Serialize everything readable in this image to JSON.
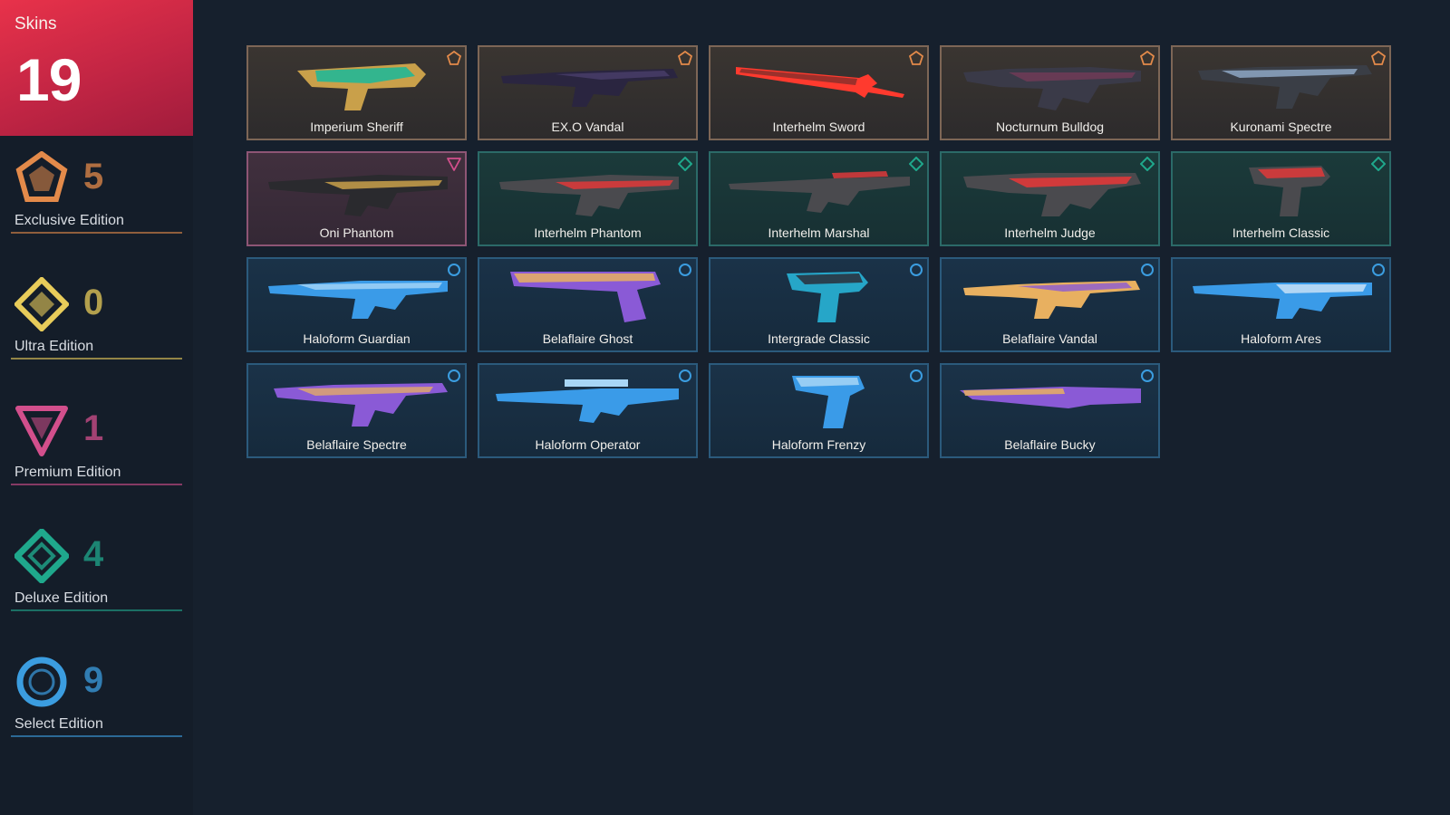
{
  "sidebar": {
    "header": {
      "label": "Skins",
      "count": "19",
      "color": "#d42a46"
    },
    "tiers": [
      {
        "id": "exclusive",
        "count": "5",
        "name": "Exclusive Edition",
        "color": "#e38a4a",
        "icon": "exclusive-edition-icon"
      },
      {
        "id": "ultra",
        "count": "0",
        "name": "Ultra Edition",
        "color": "#e8cc5a",
        "icon": "ultra-edition-icon"
      },
      {
        "id": "premium",
        "count": "1",
        "name": "Premium Edition",
        "color": "#d24f8c",
        "icon": "premium-edition-icon"
      },
      {
        "id": "deluxe",
        "count": "4",
        "name": "Deluxe Edition",
        "color": "#1fa88c",
        "icon": "deluxe-edition-icon"
      },
      {
        "id": "select",
        "count": "9",
        "name": "Select Edition",
        "color": "#3b9de0",
        "icon": "select-edition-icon"
      }
    ]
  },
  "skins": [
    {
      "name": "Imperium Sheriff",
      "tier": "exclusive",
      "palette": [
        "#19b89a",
        "#c9a04a"
      ],
      "icon": "sheriff-icon"
    },
    {
      "name": "EX.O Vandal",
      "tier": "exclusive",
      "palette": [
        "#4a3f6a",
        "#2a2540"
      ],
      "icon": "vandal-icon"
    },
    {
      "name": "Interhelm Sword",
      "tier": "exclusive",
      "palette": [
        "#ff3a2e",
        "#5a2a2a"
      ],
      "icon": "sword-icon"
    },
    {
      "name": "Nocturnum Bulldog",
      "tier": "exclusive",
      "palette": [
        "#3a3a48",
        "#7a3a5a"
      ],
      "icon": "bulldog-icon"
    },
    {
      "name": "Kuronami Spectre",
      "tier": "exclusive",
      "palette": [
        "#3a3e46",
        "#9ab6d6"
      ],
      "icon": "spectre-icon"
    },
    {
      "name": "Oni Phantom",
      "tier": "premium",
      "palette": [
        "#2a2a2e",
        "#c9a04a"
      ],
      "icon": "phantom-icon"
    },
    {
      "name": "Interhelm Phantom",
      "tier": "deluxe",
      "palette": [
        "#4a4a4e",
        "#e0383a"
      ],
      "icon": "phantom-icon"
    },
    {
      "name": "Interhelm Marshal",
      "tier": "deluxe",
      "palette": [
        "#4a4a4e",
        "#c0383a"
      ],
      "icon": "marshal-icon"
    },
    {
      "name": "Interhelm Judge",
      "tier": "deluxe",
      "palette": [
        "#4a4a4e",
        "#e0383a"
      ],
      "icon": "judge-icon"
    },
    {
      "name": "Interhelm Classic",
      "tier": "deluxe",
      "palette": [
        "#4a4a4e",
        "#e0383a"
      ],
      "icon": "classic-icon"
    },
    {
      "name": "Haloform Guardian",
      "tier": "select",
      "palette": [
        "#3a9be8",
        "#a8d6f6"
      ],
      "icon": "guardian-icon"
    },
    {
      "name": "Belaflaire Ghost",
      "tier": "select",
      "palette": [
        "#8a5ad6",
        "#e8b060"
      ],
      "icon": "ghost-icon"
    },
    {
      "name": "Intergrade Classic",
      "tier": "select",
      "palette": [
        "#26a6c8",
        "#2a2e3a"
      ],
      "icon": "classic-icon"
    },
    {
      "name": "Belaflaire Vandal",
      "tier": "select",
      "palette": [
        "#8a5ad6",
        "#e8b060"
      ],
      "icon": "vandal-icon"
    },
    {
      "name": "Haloform Ares",
      "tier": "select",
      "palette": [
        "#3a9be8",
        "#c8e0f6"
      ],
      "icon": "ares-icon"
    },
    {
      "name": "Belaflaire Spectre",
      "tier": "select",
      "palette": [
        "#8a5ad6",
        "#e8b060"
      ],
      "icon": "spectre-icon"
    },
    {
      "name": "Haloform Operator",
      "tier": "select",
      "palette": [
        "#3a9be8",
        "#a8d6f6"
      ],
      "icon": "operator-icon"
    },
    {
      "name": "Haloform Frenzy",
      "tier": "select",
      "palette": [
        "#3a9be8",
        "#a8d6f6"
      ],
      "icon": "frenzy-icon"
    },
    {
      "name": "Belaflaire Bucky",
      "tier": "select",
      "palette": [
        "#8a5ad6",
        "#e8b060"
      ],
      "icon": "bucky-icon"
    }
  ]
}
